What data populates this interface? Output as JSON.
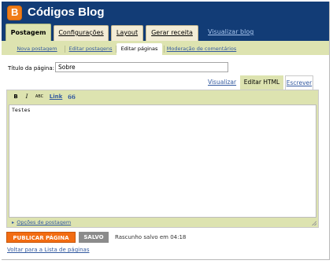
{
  "app": {
    "logo_letter": "B",
    "blog_title": "Códigos Blog"
  },
  "tabs": [
    {
      "label": "Postagem",
      "active": true
    },
    {
      "label": "Configurações",
      "active": false
    },
    {
      "label": "Layout",
      "active": false
    },
    {
      "label": "Gerar receita",
      "active": false
    }
  ],
  "view_blog_link": "Visualizar blog",
  "subtabs": [
    {
      "label": "Nova postagem",
      "active": false
    },
    {
      "label": "Editar postagens",
      "active": false
    },
    {
      "label": "Editar páginas",
      "active": true
    },
    {
      "label": "Moderação de comentários",
      "active": false
    }
  ],
  "form": {
    "title_label": "Título da página:",
    "title_value": "Sobre"
  },
  "modes": {
    "preview": "Visualizar",
    "html": "Editar HTML",
    "compose": "Escrever"
  },
  "toolbar": {
    "bold": "B",
    "italic": "I",
    "spell": "ABC",
    "link": "Link",
    "quote": "66"
  },
  "editor": {
    "content": "Testes"
  },
  "post_options": "Opções de postagem",
  "actions": {
    "publish": "PUBLICAR PÁGINA",
    "saved": "SALVO",
    "status": "Rascunho salvo em 04:18",
    "back": "Voltar para a Lista de páginas"
  },
  "colors": {
    "header": "#123c76",
    "accent": "#dde3b0",
    "publish": "#f26c12",
    "logo": "#f07c18"
  }
}
